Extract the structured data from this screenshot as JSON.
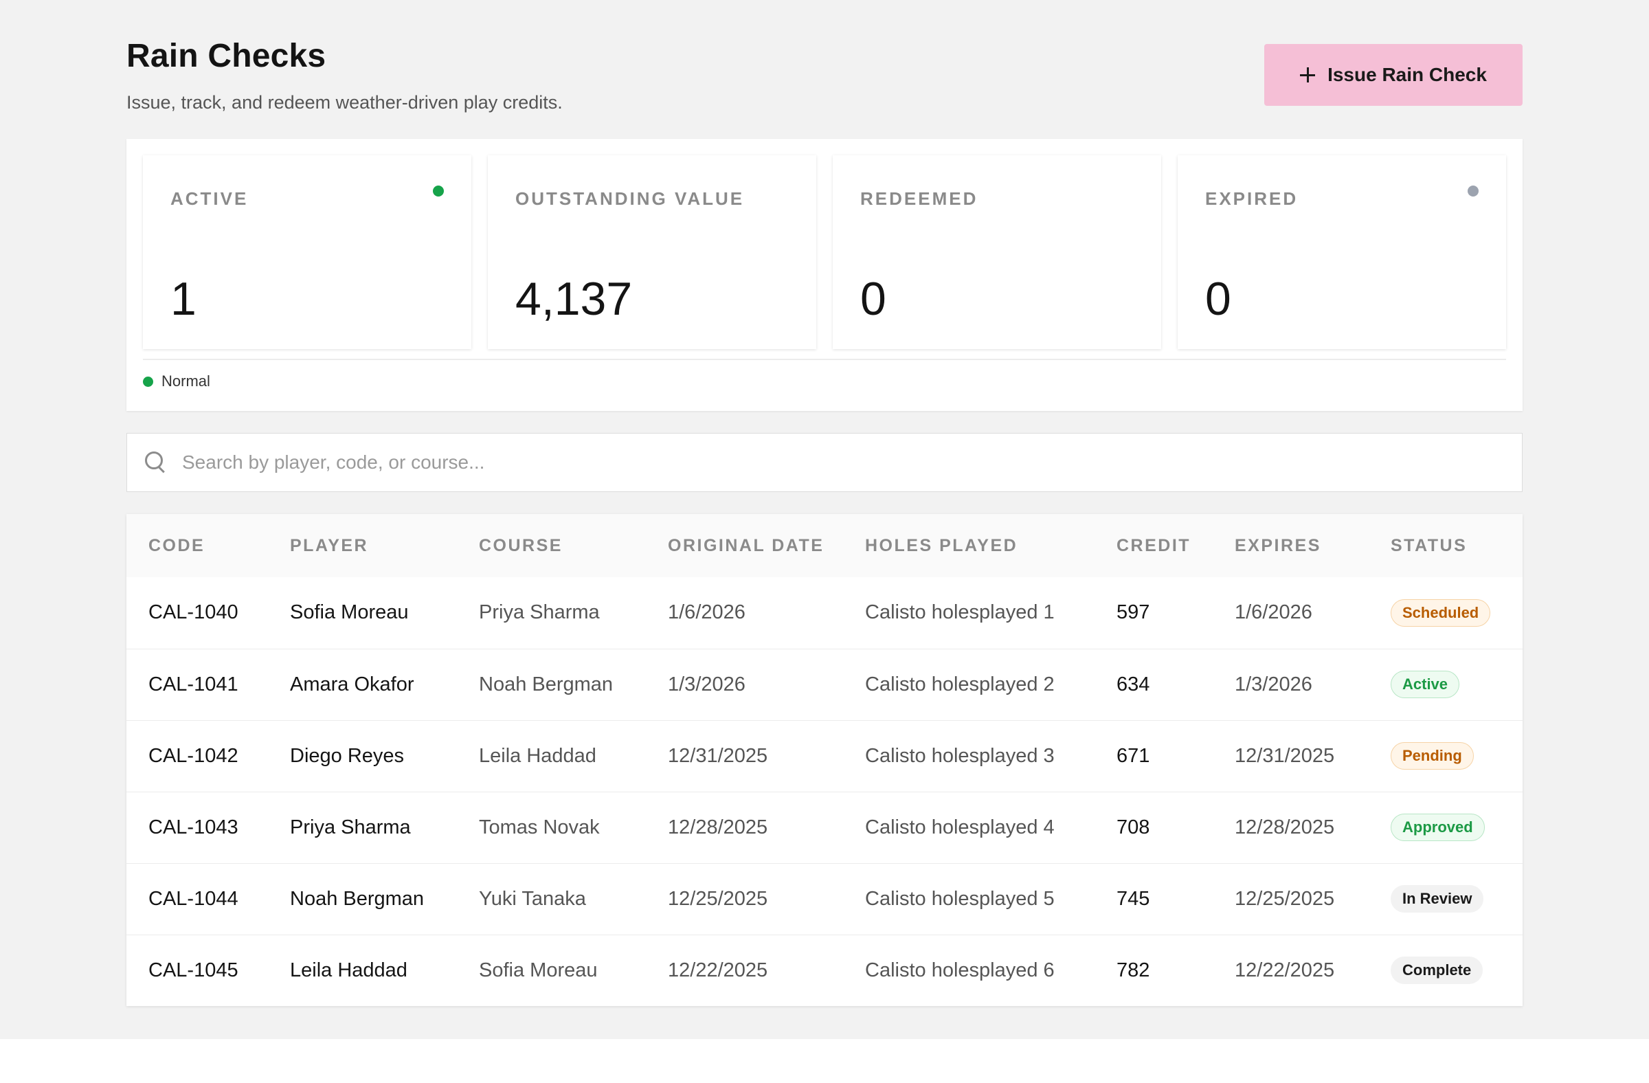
{
  "header": {
    "title": "Rain Checks",
    "subtitle": "Issue, track, and redeem weather-driven play credits.",
    "issue_button_label": "Issue Rain Check"
  },
  "stats": [
    {
      "label": "ACTIVE",
      "value": "1",
      "dot_color": "#16a34a"
    },
    {
      "label": "OUTSTANDING VALUE",
      "value": "4,137",
      "dot_color": null
    },
    {
      "label": "REDEEMED",
      "value": "0",
      "dot_color": null
    },
    {
      "label": "EXPIRED",
      "value": "0",
      "dot_color": "#9ca3af"
    }
  ],
  "legend": {
    "label": "Normal",
    "color": "#16a34a"
  },
  "search": {
    "placeholder": "Search by player, code, or course...",
    "value": ""
  },
  "table": {
    "columns": [
      "CODE",
      "PLAYER",
      "COURSE",
      "ORIGINAL DATE",
      "HOLES PLAYED",
      "CREDIT",
      "EXPIRES",
      "STATUS"
    ],
    "rows": [
      {
        "code": "CAL-1040",
        "player": "Sofia Moreau",
        "course": "Priya Sharma",
        "original_date": "1/6/2026",
        "holes_played": "Calisto holesplayed 1",
        "credit": "597",
        "expires": "1/6/2026",
        "status": "Scheduled",
        "status_tone": "orange"
      },
      {
        "code": "CAL-1041",
        "player": "Amara Okafor",
        "course": "Noah Bergman",
        "original_date": "1/3/2026",
        "holes_played": "Calisto holesplayed 2",
        "credit": "634",
        "expires": "1/3/2026",
        "status": "Active",
        "status_tone": "green"
      },
      {
        "code": "CAL-1042",
        "player": "Diego Reyes",
        "course": "Leila Haddad",
        "original_date": "12/31/2025",
        "holes_played": "Calisto holesplayed 3",
        "credit": "671",
        "expires": "12/31/2025",
        "status": "Pending",
        "status_tone": "orange"
      },
      {
        "code": "CAL-1043",
        "player": "Priya Sharma",
        "course": "Tomas Novak",
        "original_date": "12/28/2025",
        "holes_played": "Calisto holesplayed 4",
        "credit": "708",
        "expires": "12/28/2025",
        "status": "Approved",
        "status_tone": "green"
      },
      {
        "code": "CAL-1044",
        "player": "Noah Bergman",
        "course": "Yuki Tanaka",
        "original_date": "12/25/2025",
        "holes_played": "Calisto holesplayed 5",
        "credit": "745",
        "expires": "12/25/2025",
        "status": "In Review",
        "status_tone": "gray"
      },
      {
        "code": "CAL-1045",
        "player": "Leila Haddad",
        "course": "Sofia Moreau",
        "original_date": "12/22/2025",
        "holes_played": "Calisto holesplayed 6",
        "credit": "782",
        "expires": "12/22/2025",
        "status": "Complete",
        "status_tone": "gray"
      }
    ]
  },
  "colors": {
    "accent_button": "#f5bfd6",
    "page_background": "#f2f2f2"
  }
}
